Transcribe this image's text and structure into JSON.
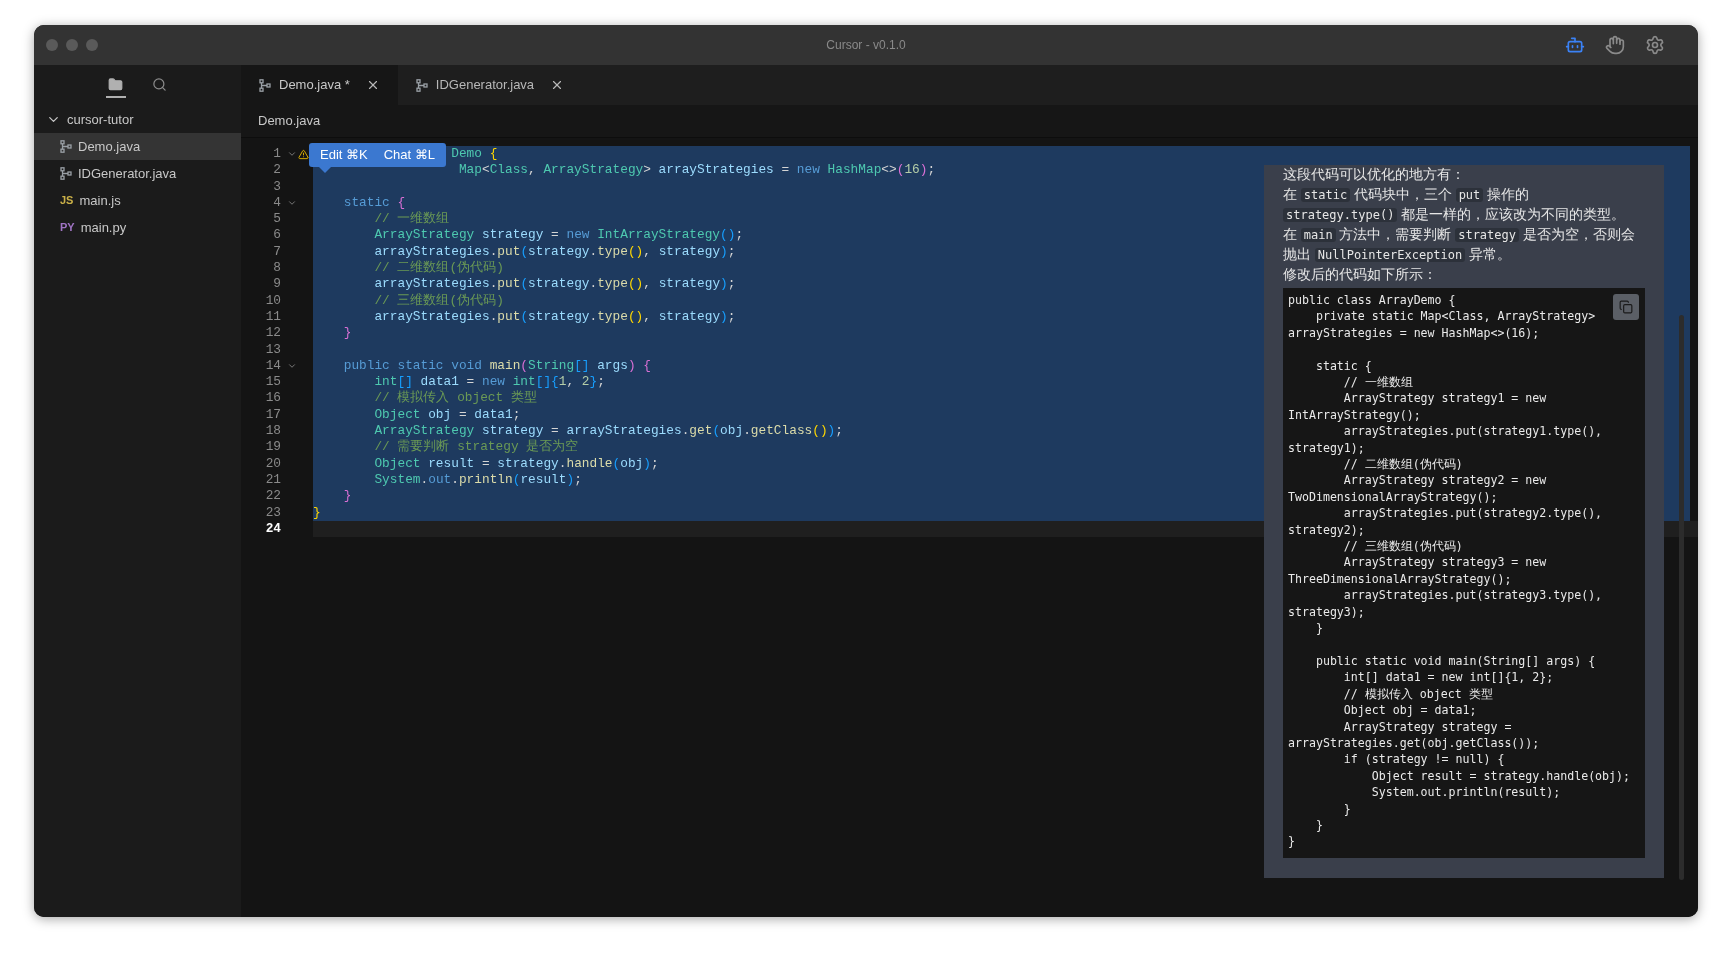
{
  "window": {
    "title": "Cursor - v0.1.0"
  },
  "toolbar_icons": [
    {
      "kind": "robot",
      "active": true
    },
    {
      "kind": "hand",
      "active": false
    },
    {
      "kind": "gear",
      "active": false
    }
  ],
  "sidebar": {
    "icons": [
      {
        "kind": "folder",
        "selected": true
      },
      {
        "kind": "search",
        "selected": false
      }
    ],
    "tree": {
      "label": "cursor-tutor",
      "expanded": true,
      "children": [
        {
          "label": "Demo.java",
          "kind": "java",
          "selected": true
        },
        {
          "label": "IDGenerator.java",
          "kind": "java",
          "selected": false
        },
        {
          "label": "main.js",
          "badge": "JS",
          "kind": "js",
          "selected": false
        },
        {
          "label": "main.py",
          "badge": "PY",
          "kind": "py",
          "selected": false
        }
      ]
    }
  },
  "tabs": [
    {
      "label": "Demo.java *",
      "selected": true
    },
    {
      "label": "IDGenerator.java",
      "selected": false
    }
  ],
  "breadcrumb": "Demo.java",
  "popup": {
    "buttons": [
      "Edit ⌘K",
      "Chat ⌘L"
    ]
  },
  "code_lines": [
    {
      "no": "1",
      "fold": true,
      "warning": true,
      "current": false,
      "tokens": [
        {
          "t": "                  Demo",
          "kind": "type"
        },
        {
          "t": " {",
          "kind": "b1"
        }
      ]
    },
    {
      "no": "2",
      "fold": false,
      "warning": false,
      "current": false,
      "tokens": [
        {
          "t": "                   Map",
          "kind": "type"
        },
        {
          "t": "<",
          "kind": "p"
        },
        {
          "t": "Class",
          "kind": "type"
        },
        {
          "t": ", ",
          "kind": "p"
        },
        {
          "t": "ArrayStrategy",
          "kind": "type"
        },
        {
          "t": "> ",
          "kind": "p"
        },
        {
          "t": "arrayStrategies",
          "kind": "var"
        },
        {
          "t": " = ",
          "kind": "p"
        },
        {
          "t": "new",
          "kind": "kw"
        },
        {
          "t": " HashMap",
          "kind": "type"
        },
        {
          "t": "<>",
          "kind": "p"
        },
        {
          "t": "(",
          "kind": "b2"
        },
        {
          "t": "16",
          "kind": "num"
        },
        {
          "t": ")",
          "kind": "b2"
        },
        {
          "t": ";",
          "kind": "p"
        }
      ]
    },
    {
      "no": "3",
      "fold": false,
      "warning": false,
      "current": false
    },
    {
      "no": "4",
      "fold": true,
      "warning": false,
      "current": false,
      "tokens": [
        {
          "t": "    static",
          "kind": "kw"
        },
        {
          "t": " {",
          "kind": "b2"
        }
      ]
    },
    {
      "no": "5",
      "fold": false,
      "warning": false,
      "current": false,
      "tokens": [
        {
          "t": "        // 一维数组",
          "kind": "cm"
        }
      ]
    },
    {
      "no": "6",
      "fold": false,
      "warning": false,
      "current": false,
      "tokens": [
        {
          "t": "        ArrayStrategy",
          "kind": "type"
        },
        {
          "t": " strategy",
          "kind": "var"
        },
        {
          "t": " = ",
          "kind": "p"
        },
        {
          "t": "new",
          "kind": "kw"
        },
        {
          "t": " IntArrayStrategy",
          "kind": "type"
        },
        {
          "t": "()",
          "kind": "b3"
        },
        {
          "t": ";",
          "kind": "p"
        }
      ]
    },
    {
      "no": "7",
      "fold": false,
      "warning": false,
      "current": false,
      "tokens": [
        {
          "t": "        arrayStrategies",
          "kind": "var"
        },
        {
          "t": ".",
          "kind": "p"
        },
        {
          "t": "put",
          "kind": "fn"
        },
        {
          "t": "(",
          "kind": "b3"
        },
        {
          "t": "strategy",
          "kind": "var"
        },
        {
          "t": ".",
          "kind": "p"
        },
        {
          "t": "type",
          "kind": "fn"
        },
        {
          "t": "()",
          "kind": "b1"
        },
        {
          "t": ", ",
          "kind": "p"
        },
        {
          "t": "strategy",
          "kind": "var"
        },
        {
          "t": ")",
          "kind": "b3"
        },
        {
          "t": ";",
          "kind": "p"
        }
      ]
    },
    {
      "no": "8",
      "fold": false,
      "warning": false,
      "current": false,
      "tokens": [
        {
          "t": "        // 二维数组(伪代码)",
          "kind": "cm"
        }
      ]
    },
    {
      "no": "9",
      "fold": false,
      "warning": false,
      "current": false,
      "tokens": [
        {
          "t": "        arrayStrategies",
          "kind": "var"
        },
        {
          "t": ".",
          "kind": "p"
        },
        {
          "t": "put",
          "kind": "fn"
        },
        {
          "t": "(",
          "kind": "b3"
        },
        {
          "t": "strategy",
          "kind": "var"
        },
        {
          "t": ".",
          "kind": "p"
        },
        {
          "t": "type",
          "kind": "fn"
        },
        {
          "t": "()",
          "kind": "b1"
        },
        {
          "t": ", ",
          "kind": "p"
        },
        {
          "t": "strategy",
          "kind": "var"
        },
        {
          "t": ")",
          "kind": "b3"
        },
        {
          "t": ";",
          "kind": "p"
        }
      ]
    },
    {
      "no": "10",
      "fold": false,
      "warning": false,
      "current": false,
      "tokens": [
        {
          "t": "        // 三维数组(伪代码)",
          "kind": "cm"
        }
      ]
    },
    {
      "no": "11",
      "fold": false,
      "warning": false,
      "current": false,
      "tokens": [
        {
          "t": "        arrayStrategies",
          "kind": "var"
        },
        {
          "t": ".",
          "kind": "p"
        },
        {
          "t": "put",
          "kind": "fn"
        },
        {
          "t": "(",
          "kind": "b3"
        },
        {
          "t": "strategy",
          "kind": "var"
        },
        {
          "t": ".",
          "kind": "p"
        },
        {
          "t": "type",
          "kind": "fn"
        },
        {
          "t": "()",
          "kind": "b1"
        },
        {
          "t": ", ",
          "kind": "p"
        },
        {
          "t": "strategy",
          "kind": "var"
        },
        {
          "t": ")",
          "kind": "b3"
        },
        {
          "t": ";",
          "kind": "p"
        }
      ]
    },
    {
      "no": "12",
      "fold": false,
      "warning": false,
      "current": false,
      "tokens": [
        {
          "t": "    }",
          "kind": "b2"
        }
      ]
    },
    {
      "no": "13",
      "fold": false,
      "warning": false,
      "current": false
    },
    {
      "no": "14",
      "fold": true,
      "warning": false,
      "current": false,
      "tokens": [
        {
          "t": "    public static void",
          "kind": "kw"
        },
        {
          "t": " main",
          "kind": "fn"
        },
        {
          "t": "(",
          "kind": "b2"
        },
        {
          "t": "String",
          "kind": "type"
        },
        {
          "t": "[]",
          "kind": "b3"
        },
        {
          "t": " args",
          "kind": "var"
        },
        {
          "t": ")",
          "kind": "b2"
        },
        {
          "t": " {",
          "kind": "b2"
        }
      ]
    },
    {
      "no": "15",
      "fold": false,
      "warning": false,
      "current": false,
      "tokens": [
        {
          "t": "        int",
          "kind": "type"
        },
        {
          "t": "[]",
          "kind": "b3"
        },
        {
          "t": " data1",
          "kind": "var"
        },
        {
          "t": " = ",
          "kind": "p"
        },
        {
          "t": "new",
          "kind": "kw"
        },
        {
          "t": " int",
          "kind": "type"
        },
        {
          "t": "[]",
          "kind": "b3"
        },
        {
          "t": "{",
          "kind": "b3"
        },
        {
          "t": "1",
          "kind": "num"
        },
        {
          "t": ", ",
          "kind": "p"
        },
        {
          "t": "2",
          "kind": "num"
        },
        {
          "t": "}",
          "kind": "b3"
        },
        {
          "t": ";",
          "kind": "p"
        }
      ]
    },
    {
      "no": "16",
      "fold": false,
      "warning": false,
      "current": false,
      "tokens": [
        {
          "t": "        // 模拟传入 object 类型",
          "kind": "cm"
        }
      ]
    },
    {
      "no": "17",
      "fold": false,
      "warning": false,
      "current": false,
      "tokens": [
        {
          "t": "        Object",
          "kind": "type"
        },
        {
          "t": " obj",
          "kind": "var"
        },
        {
          "t": " = ",
          "kind": "p"
        },
        {
          "t": "data1",
          "kind": "var"
        },
        {
          "t": ";",
          "kind": "p"
        }
      ]
    },
    {
      "no": "18",
      "fold": false,
      "warning": false,
      "current": false,
      "tokens": [
        {
          "t": "        ArrayStrategy",
          "kind": "type"
        },
        {
          "t": " strategy",
          "kind": "var"
        },
        {
          "t": " = ",
          "kind": "p"
        },
        {
          "t": "arrayStrategies",
          "kind": "var"
        },
        {
          "t": ".",
          "kind": "p"
        },
        {
          "t": "get",
          "kind": "fn"
        },
        {
          "t": "(",
          "kind": "b3"
        },
        {
          "t": "obj",
          "kind": "var"
        },
        {
          "t": ".",
          "kind": "p"
        },
        {
          "t": "getClass",
          "kind": "fn"
        },
        {
          "t": "()",
          "kind": "b1"
        },
        {
          "t": ")",
          "kind": "b3"
        },
        {
          "t": ";",
          "kind": "p"
        }
      ]
    },
    {
      "no": "19",
      "fold": false,
      "warning": false,
      "current": false,
      "tokens": [
        {
          "t": "        // 需要判断 strategy 是否为空",
          "kind": "cm"
        }
      ]
    },
    {
      "no": "20",
      "fold": false,
      "warning": false,
      "current": false,
      "tokens": [
        {
          "t": "        Object",
          "kind": "type"
        },
        {
          "t": " result",
          "kind": "var"
        },
        {
          "t": " = ",
          "kind": "p"
        },
        {
          "t": "strategy",
          "kind": "var"
        },
        {
          "t": ".",
          "kind": "p"
        },
        {
          "t": "handle",
          "kind": "fn"
        },
        {
          "t": "(",
          "kind": "b3"
        },
        {
          "t": "obj",
          "kind": "var"
        },
        {
          "t": ")",
          "kind": "b3"
        },
        {
          "t": ";",
          "kind": "p"
        }
      ]
    },
    {
      "no": "21",
      "fold": false,
      "warning": false,
      "current": false,
      "tokens": [
        {
          "t": "        System",
          "kind": "type"
        },
        {
          "t": ".",
          "kind": "p"
        },
        {
          "t": "out",
          "kind": "kw"
        },
        {
          "t": ".",
          "kind": "p"
        },
        {
          "t": "println",
          "kind": "fn"
        },
        {
          "t": "(",
          "kind": "b3"
        },
        {
          "t": "result",
          "kind": "var"
        },
        {
          "t": ")",
          "kind": "b3"
        },
        {
          "t": ";",
          "kind": "p"
        }
      ]
    },
    {
      "no": "22",
      "fold": false,
      "warning": false,
      "current": false,
      "tokens": [
        {
          "t": "    }",
          "kind": "b2"
        }
      ]
    },
    {
      "no": "23",
      "fold": false,
      "warning": false,
      "current": false,
      "tokens": [
        {
          "t": "}",
          "kind": "b1"
        }
      ]
    },
    {
      "no": "24",
      "fold": false,
      "warning": false,
      "current": true
    }
  ],
  "chat": {
    "paragraphs": [
      [
        {
          "kind": "text",
          "t": "这段代码可以优化的地方有："
        }
      ],
      [
        {
          "kind": "text",
          "t": "在 "
        },
        {
          "kind": "code",
          "t": "static"
        },
        {
          "kind": "text",
          "t": " 代码块中，三个 "
        },
        {
          "kind": "code",
          "t": "put"
        },
        {
          "kind": "text",
          "t": " 操作的 "
        },
        {
          "kind": "code",
          "t": "strategy.type()"
        },
        {
          "kind": "text",
          "t": " 都是一样的，应该改为不同的类型。"
        }
      ],
      [
        {
          "kind": "text",
          "t": "在 "
        },
        {
          "kind": "code",
          "t": "main"
        },
        {
          "kind": "text",
          "t": " 方法中，需要判断 "
        },
        {
          "kind": "code",
          "t": "strategy"
        },
        {
          "kind": "text",
          "t": " 是否为空，否则会抛出 "
        },
        {
          "kind": "code",
          "t": "NullPointerException"
        },
        {
          "kind": "text",
          "t": " 异常。"
        }
      ],
      [
        {
          "kind": "text",
          "t": "修改后的代码如下所示："
        }
      ]
    ],
    "code_block": [
      [
        "public class ArrayDemo {",
        "    private static Map<Class, ArrayStrategy>",
        "arrayStrategies = new HashMap<>(16);"
      ],
      [
        "    static {",
        "        // 一维数组",
        "        ArrayStrategy strategy1 = new",
        "IntArrayStrategy();",
        "        arrayStrategies.put(strategy1.type(),",
        "strategy1);",
        "        // 二维数组(伪代码)",
        "        ArrayStrategy strategy2 = new",
        "TwoDimensionalArrayStrategy();",
        "        arrayStrategies.put(strategy2.type(),",
        "strategy2);",
        "        // 三维数组(伪代码)",
        "        ArrayStrategy strategy3 = new",
        "ThreeDimensionalArrayStrategy();",
        "        arrayStrategies.put(strategy3.type(),",
        "strategy3);",
        "    }"
      ],
      [
        "    public static void main(String[] args) {",
        "        int[] data1 = new int[]{1, 2};",
        "        // 模拟传入 object 类型",
        "        Object obj = data1;",
        "        ArrayStrategy strategy =",
        "arrayStrategies.get(obj.getClass());",
        "        if (strategy != null) {",
        "            Object result = strategy.handle(obj);",
        "            System.out.println(result);",
        "        }",
        "    }",
        "}"
      ]
    ]
  }
}
